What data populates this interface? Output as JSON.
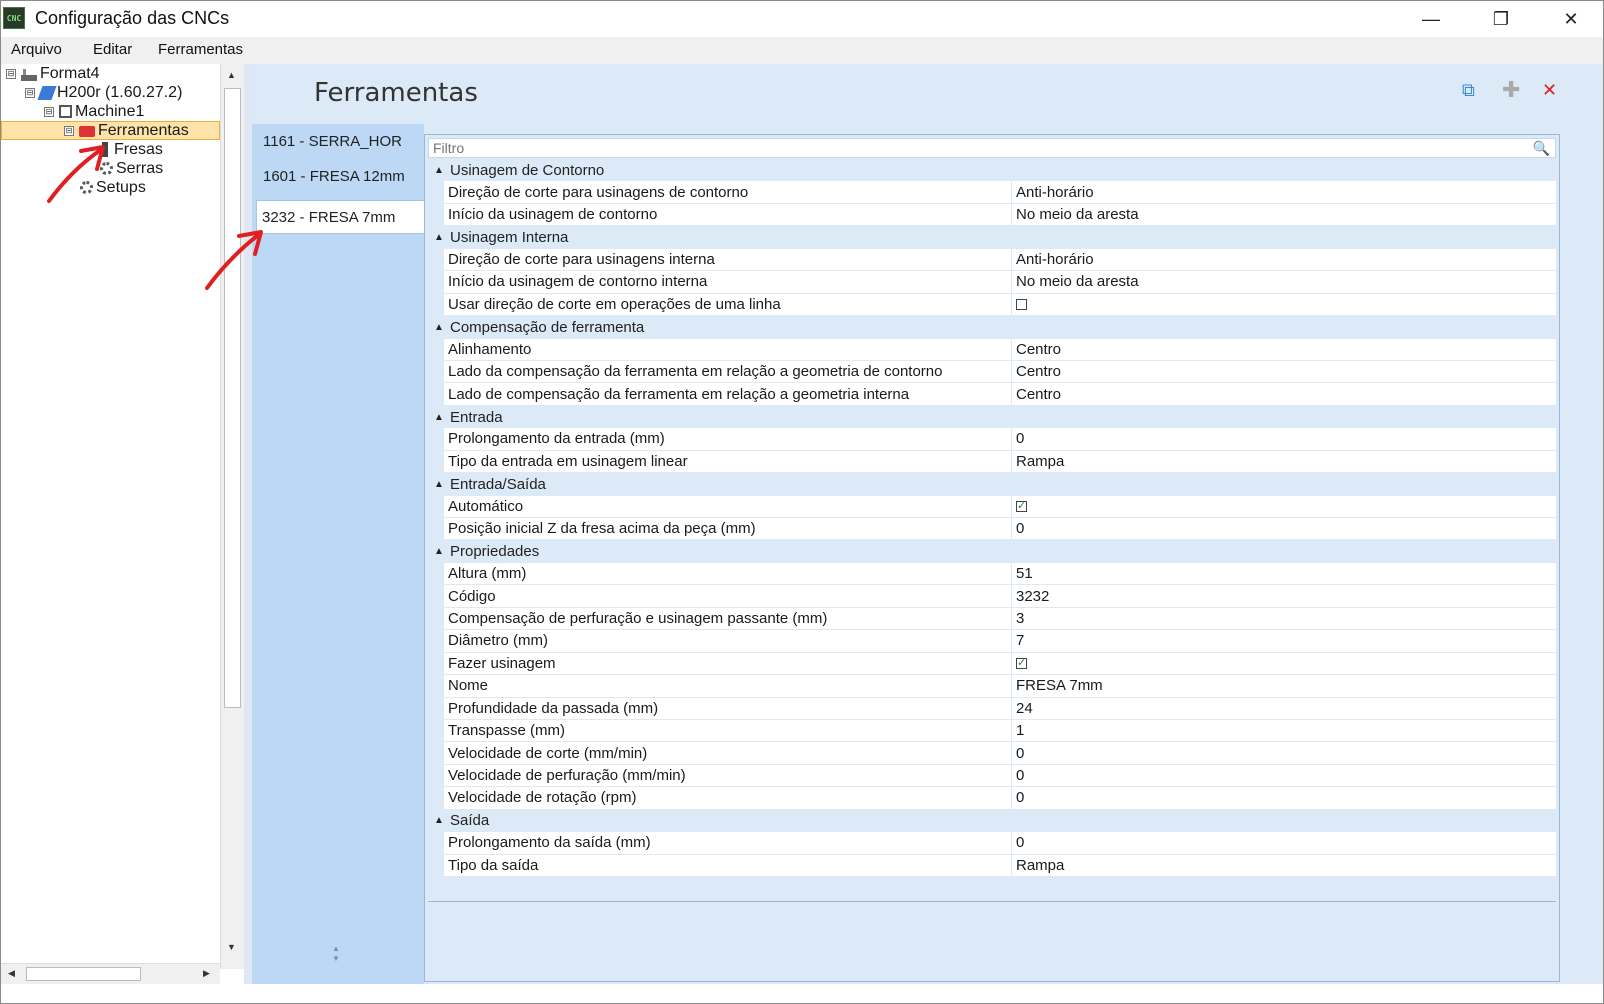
{
  "window": {
    "title": "Configuração das CNCs",
    "app_icon_text": "CNC"
  },
  "menu": [
    "Arquivo",
    "Editar",
    "Ferramentas"
  ],
  "tree": [
    {
      "label": "Format4",
      "expander": "⊟"
    },
    {
      "label": "H200r (1.60.27.2)",
      "expander": "⊟"
    },
    {
      "label": "Machine1",
      "expander": "⊟"
    },
    {
      "label": "Ferramentas",
      "expander": "⊟"
    },
    {
      "label": "Fresas"
    },
    {
      "label": "Serras"
    },
    {
      "label": "Setups"
    }
  ],
  "panel": {
    "title": "Ferramentas"
  },
  "tool_tabs": [
    "1161 - SERRA_HOR",
    "1601 - FRESA 12mm",
    "3232 - FRESA 7mm"
  ],
  "active_tab": "3232 - FRESA 7mm",
  "filter": {
    "placeholder": "Filtro"
  },
  "categories": [
    {
      "name": "Usinagem de Contorno",
      "rows": [
        {
          "name": "Direção de corte para usinagens de contorno",
          "value": "Anti-horário"
        },
        {
          "name": "Início da usinagem de contorno",
          "value": "No meio da aresta"
        }
      ]
    },
    {
      "name": "Usinagem Interna",
      "rows": [
        {
          "name": "Direção de corte para usinagens interna",
          "value": "Anti-horário"
        },
        {
          "name": "Início da usinagem de contorno interna",
          "value": "No meio da aresta"
        },
        {
          "name": "Usar direção de corte em operações de uma linha",
          "value": false,
          "checkbox": true
        }
      ]
    },
    {
      "name": "Compensação de ferramenta",
      "rows": [
        {
          "name": "Alinhamento",
          "value": "Centro"
        },
        {
          "name": "Lado da compensação da ferramenta em relação a geometria de contorno",
          "value": "Centro"
        },
        {
          "name": "Lado de compensação da ferramenta em relação a geometria interna",
          "value": "Centro"
        }
      ]
    },
    {
      "name": "Entrada",
      "rows": [
        {
          "name": "Prolongamento da entrada (mm)",
          "value": "0"
        },
        {
          "name": "Tipo da entrada em usinagem linear",
          "value": "Rampa"
        }
      ]
    },
    {
      "name": "Entrada/Saída",
      "rows": [
        {
          "name": "Automático",
          "value": true,
          "checkbox": true
        },
        {
          "name": "Posição inicial Z da fresa acima da peça (mm)",
          "value": "0"
        }
      ]
    },
    {
      "name": "Propriedades",
      "rows": [
        {
          "name": "Altura (mm)",
          "value": "51"
        },
        {
          "name": "Código",
          "value": "3232"
        },
        {
          "name": "Compensação de perfuração e usinagem passante (mm)",
          "value": "3"
        },
        {
          "name": "Diâmetro (mm)",
          "value": "7"
        },
        {
          "name": "Fazer usinagem",
          "value": true,
          "checkbox": true
        },
        {
          "name": "Nome",
          "value": "FRESA 7mm"
        },
        {
          "name": "Profundidade da passada (mm)",
          "value": "24"
        },
        {
          "name": "Transpasse (mm)",
          "value": "1"
        },
        {
          "name": "Velocidade de corte (mm/min)",
          "value": "0"
        },
        {
          "name": "Velocidade de perfuração (mm/min)",
          "value": "0"
        },
        {
          "name": "Velocidade de rotação (rpm)",
          "value": "0"
        }
      ]
    },
    {
      "name": "Saída",
      "rows": [
        {
          "name": "Prolongamento da saída (mm)",
          "value": "0"
        },
        {
          "name": "Tipo da saída",
          "value": "Rampa"
        }
      ]
    }
  ],
  "colors": {
    "accent": "#dce9f7",
    "tab_column": "#bcd8f5",
    "selection": "#fde3a8",
    "annotation_arrow": "#e02020"
  },
  "icons": {
    "copy": "copy-icon",
    "add": "plus-icon",
    "delete": "close-x-icon",
    "search": "search-icon"
  }
}
